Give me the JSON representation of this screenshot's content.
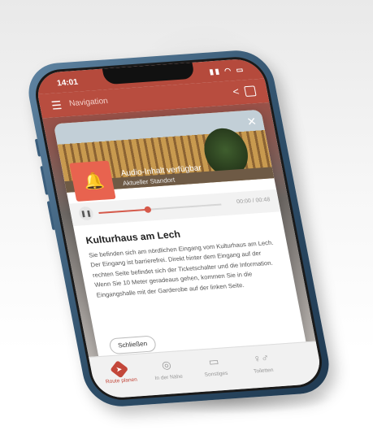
{
  "status_bar": {
    "time": "14:01",
    "icons": "▮▮ ◠ ▭"
  },
  "app_bar": {
    "title": "Navigation"
  },
  "modal": {
    "audio_title": "Audio-Inhalt verfügbar",
    "audio_subtitle": "Aktueller Standort",
    "player": {
      "time": "00:00 / 00:48",
      "progress": 0.4
    },
    "title": "Kulturhaus am Lech",
    "body": "Sie befinden sich am nördlichen Eingang vom Kulturhaus am Lech. Der Eingang ist barrierefrei. Direkt hinter dem Eingang auf der rechten Seite befindet sich der Ticketschalter und die Information. Wenn Sie 10 Meter geradeaus gehen, kommen Sie in die Eingangshalle mit der Garderobe auf der linken Seite.",
    "close_label": "Schließen"
  },
  "tabs": [
    {
      "label": "Route planen",
      "icon": "route-icon",
      "active": true
    },
    {
      "label": "In der Nähe",
      "icon": "location-icon",
      "active": false
    },
    {
      "label": "Sonstiges",
      "icon": "chat-icon",
      "active": false
    },
    {
      "label": "Toiletten",
      "icon": "toilet-icon",
      "active": false
    }
  ],
  "colors": {
    "accent": "#c3473a",
    "phone": "#2e4e69"
  }
}
